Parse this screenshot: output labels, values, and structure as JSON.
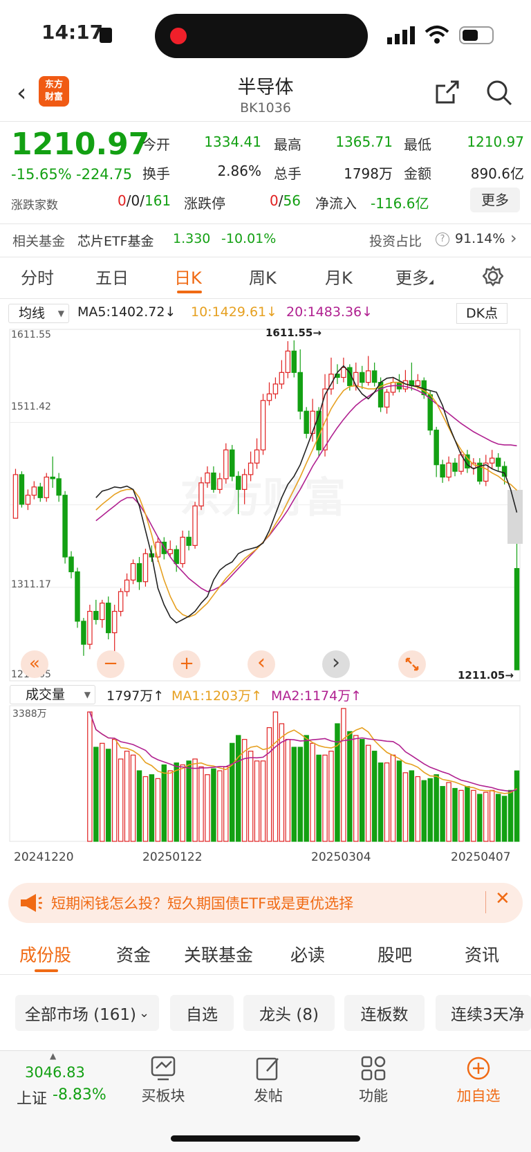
{
  "status_bar": {
    "time": "14:17"
  },
  "header": {
    "title": "半导体",
    "code": "BK1036",
    "logo_text_1": "东方",
    "logo_text_2": "财富"
  },
  "quote": {
    "price": "1210.97",
    "change_pct": "-15.65%",
    "change": "-224.75",
    "open_label": "今开",
    "open": "1334.41",
    "high_label": "最高",
    "high": "1365.71",
    "low_label": "最低",
    "low": "1210.97",
    "turnover_label": "换手",
    "turnover": "2.86%",
    "volume_label": "总手",
    "volume": "1798万",
    "amount_label": "金额",
    "amount": "890.6亿",
    "breadth_label": "涨跌家数",
    "breadth_up": "0",
    "breadth_flat": "0",
    "breadth_down": "161",
    "limit_label": "涨跌停",
    "limit_up": "0",
    "limit_down": "56",
    "netflow_label": "净流入",
    "netflow": "-116.6亿",
    "more_button": "更多"
  },
  "fund": {
    "label": "相关基金",
    "name": "芯片ETF基金",
    "price": "1.330",
    "pct": "-10.01%",
    "ratio_label": "投资占比",
    "ratio": "91.14%"
  },
  "period_tabs": [
    "分时",
    "五日",
    "日K",
    "周K",
    "月K",
    "更多"
  ],
  "active_period": "日K",
  "ma_bar": {
    "selector": "均线",
    "ma5": "MA5:1402.72",
    "ma10": "10:1429.61",
    "ma20": "20:1483.36",
    "dk_button": "DK点"
  },
  "vol_bar": {
    "selector": "成交量",
    "vol": "1797万",
    "ma1": "MA1:1203万",
    "ma2": "MA2:1174万"
  },
  "chart_data": {
    "type": "candlestick",
    "price_axis_labels": [
      "1611.55",
      "1511.42",
      "1311.17",
      "1211.05"
    ],
    "high_marker": "1611.55",
    "low_marker": "1211.05",
    "volume_axis_label": "3388万",
    "date_labels": [
      "20241220",
      "20250122",
      "20250304",
      "20250407"
    ],
    "candles": [
      [
        1395,
        1448,
        1400,
        1455
      ],
      [
        1448,
        1412,
        1408,
        1452
      ],
      [
        1412,
        1423,
        1405,
        1430
      ],
      [
        1423,
        1433,
        1418,
        1440
      ],
      [
        1433,
        1420,
        1415,
        1438
      ],
      [
        1420,
        1445,
        1415,
        1450
      ],
      [
        1445,
        1443,
        1432,
        1470
      ],
      [
        1443,
        1423,
        1415,
        1450
      ],
      [
        1423,
        1348,
        1340,
        1428
      ],
      [
        1348,
        1330,
        1322,
        1355
      ],
      [
        1330,
        1270,
        1262,
        1335
      ],
      [
        1270,
        1242,
        1228,
        1274
      ],
      [
        1242,
        1282,
        1236,
        1290
      ],
      [
        1282,
        1272,
        1266,
        1296
      ],
      [
        1272,
        1292,
        1262,
        1296
      ],
      [
        1292,
        1256,
        1248,
        1300
      ],
      [
        1256,
        1282,
        1230,
        1290
      ],
      [
        1282,
        1306,
        1276,
        1310
      ],
      [
        1306,
        1320,
        1300,
        1328
      ],
      [
        1320,
        1340,
        1315,
        1345
      ],
      [
        1340,
        1318,
        1308,
        1348
      ],
      [
        1318,
        1352,
        1312,
        1358
      ],
      [
        1352,
        1348,
        1342,
        1362
      ],
      [
        1348,
        1366,
        1342,
        1372
      ],
      [
        1366,
        1352,
        1345,
        1372
      ],
      [
        1352,
        1357,
        1348,
        1368
      ],
      [
        1357,
        1340,
        1330,
        1362
      ],
      [
        1340,
        1372,
        1335,
        1380
      ],
      [
        1372,
        1362,
        1356,
        1380
      ],
      [
        1362,
        1410,
        1358,
        1415
      ],
      [
        1410,
        1438,
        1405,
        1445
      ],
      [
        1438,
        1450,
        1432,
        1458
      ],
      [
        1450,
        1430,
        1426,
        1458
      ],
      [
        1430,
        1443,
        1425,
        1450
      ],
      [
        1443,
        1478,
        1437,
        1486
      ],
      [
        1478,
        1446,
        1440,
        1484
      ],
      [
        1446,
        1430,
        1400,
        1452
      ],
      [
        1430,
        1448,
        1412,
        1455
      ],
      [
        1448,
        1462,
        1440,
        1476
      ],
      [
        1462,
        1478,
        1455,
        1492
      ],
      [
        1478,
        1538,
        1472,
        1546
      ],
      [
        1538,
        1546,
        1532,
        1560
      ],
      [
        1546,
        1558,
        1540,
        1566
      ],
      [
        1558,
        1572,
        1552,
        1587
      ],
      [
        1572,
        1598,
        1565,
        1610
      ],
      [
        1598,
        1572,
        1566,
        1611
      ],
      [
        1572,
        1525,
        1515,
        1600
      ],
      [
        1525,
        1498,
        1492,
        1530
      ],
      [
        1498,
        1525,
        1488,
        1540
      ],
      [
        1525,
        1478,
        1470,
        1530
      ],
      [
        1478,
        1552,
        1470,
        1570
      ],
      [
        1552,
        1570,
        1545,
        1590
      ],
      [
        1570,
        1566,
        1558,
        1582
      ],
      [
        1566,
        1578,
        1560,
        1590
      ],
      [
        1578,
        1556,
        1550,
        1582
      ],
      [
        1556,
        1572,
        1550,
        1584
      ],
      [
        1572,
        1560,
        1552,
        1580
      ],
      [
        1560,
        1574,
        1556,
        1592
      ],
      [
        1574,
        1560,
        1555,
        1584
      ],
      [
        1560,
        1530,
        1524,
        1566
      ],
      [
        1530,
        1548,
        1522,
        1552
      ],
      [
        1548,
        1560,
        1544,
        1566
      ],
      [
        1560,
        1552,
        1548,
        1570
      ],
      [
        1552,
        1562,
        1548,
        1575
      ],
      [
        1562,
        1556,
        1550,
        1584
      ],
      [
        1556,
        1562,
        1552,
        1570
      ],
      [
        1562,
        1545,
        1540,
        1566
      ],
      [
        1545,
        1502,
        1496,
        1550
      ],
      [
        1502,
        1460,
        1445,
        1506
      ],
      [
        1460,
        1445,
        1438,
        1466
      ],
      [
        1445,
        1462,
        1440,
        1470
      ],
      [
        1462,
        1452,
        1446,
        1468
      ],
      [
        1452,
        1472,
        1448,
        1476
      ],
      [
        1472,
        1456,
        1450,
        1478
      ],
      [
        1456,
        1462,
        1448,
        1468
      ],
      [
        1462,
        1440,
        1436,
        1468
      ],
      [
        1440,
        1462,
        1434,
        1472
      ],
      [
        1462,
        1468,
        1455,
        1478
      ],
      [
        1468,
        1458,
        1452,
        1474
      ],
      [
        1458,
        1446,
        1436,
        1464
      ],
      [
        1418,
        1366,
        1364,
        1420
      ],
      [
        1334,
        1211,
        1211,
        1366
      ]
    ],
    "ma5": [
      1420,
      1428,
      1430,
      1433,
      1432,
      1434,
      1430,
      1410,
      1380,
      1350,
      1310,
      1290,
      1275,
      1268,
      1272,
      1276,
      1282,
      1292,
      1300,
      1320,
      1332,
      1338,
      1342,
      1352,
      1356,
      1358,
      1360,
      1365,
      1380,
      1400,
      1420,
      1436,
      1446,
      1460,
      1480,
      1500,
      1520,
      1545,
      1558,
      1572,
      1580,
      1572,
      1556,
      1546,
      1540,
      1548,
      1560,
      1565,
      1566,
      1562,
      1558,
      1556,
      1555,
      1552,
      1550,
      1548,
      1532,
      1508,
      1490,
      1472,
      1460,
      1455,
      1458,
      1460,
      1455,
      1452,
      1450,
      1430,
      1402
    ],
    "ma10": [
      1405,
      1412,
      1418,
      1424,
      1428,
      1430,
      1430,
      1420,
      1400,
      1375,
      1345,
      1320,
      1300,
      1285,
      1278,
      1275,
      1278,
      1285,
      1292,
      1302,
      1312,
      1322,
      1330,
      1338,
      1346,
      1352,
      1358,
      1366,
      1375,
      1388,
      1400,
      1415,
      1430,
      1445,
      1462,
      1478,
      1495,
      1512,
      1528,
      1540,
      1550,
      1555,
      1556,
      1554,
      1552,
      1552,
      1555,
      1558,
      1560,
      1560,
      1558,
      1556,
      1554,
      1550,
      1545,
      1535,
      1520,
      1505,
      1490,
      1478,
      1468,
      1460,
      1458,
      1455,
      1450,
      1446,
      1440,
      1436,
      1429
    ],
    "ma20": [
      1392,
      1398,
      1404,
      1410,
      1416,
      1420,
      1420,
      1412,
      1400,
      1386,
      1372,
      1360,
      1348,
      1338,
      1330,
      1322,
      1316,
      1310,
      1306,
      1308,
      1312,
      1318,
      1326,
      1334,
      1342,
      1350,
      1358,
      1366,
      1374,
      1384,
      1394,
      1405,
      1418,
      1430,
      1444,
      1458,
      1470,
      1482,
      1494,
      1505,
      1515,
      1524,
      1532,
      1538,
      1543,
      1548,
      1552,
      1555,
      1556,
      1556,
      1555,
      1553,
      1550,
      1546,
      1540,
      1534,
      1528,
      1522,
      1516,
      1510,
      1505,
      1500,
      1496,
      1492,
      1488,
      1485,
      1484,
      1484,
      1483
    ],
    "volumes": [
      3300,
      2400,
      2500,
      2350,
      2600,
      2100,
      2300,
      2200,
      1800,
      1650,
      1700,
      1600,
      1950,
      1800,
      2000,
      1950,
      2050,
      2100,
      1900,
      1700,
      1850,
      1800,
      1900,
      2500,
      2700,
      2600,
      2300,
      2050,
      2050,
      2900,
      3300,
      3000,
      2600,
      2400,
      2400,
      2700,
      2500,
      2200,
      2200,
      2300,
      3000,
      3388,
      2800,
      2700,
      2600,
      2450,
      2300,
      2000,
      2000,
      2200,
      2050,
      1750,
      1800,
      1650,
      1550,
      1600,
      1700,
      1400,
      1500,
      1350,
      1300,
      1400,
      1300,
      1200,
      1250,
      1300,
      1200,
      1150,
      1300,
      1797
    ]
  },
  "controls": {
    "rewind": "«",
    "zoom_out": "−",
    "zoom_in": "+",
    "prev": "‹",
    "next": "›"
  },
  "banner": {
    "text": "短期闲钱怎么投？短久期国债ETF或是更优选择"
  },
  "bottom_tabs": [
    "成份股",
    "资金",
    "关联基金",
    "必读",
    "股吧",
    "资讯"
  ],
  "active_bottom_tab": "成份股",
  "filter_chips": [
    "全部市场 (161)",
    "自选",
    "龙头 (8)",
    "连板数",
    "连续3天净"
  ],
  "index_ticker": {
    "value": "3046.83",
    "name": "上证",
    "pct": "-8.83%"
  },
  "bottom_bar": [
    "买板块",
    "发帖",
    "功能",
    "加自选"
  ]
}
